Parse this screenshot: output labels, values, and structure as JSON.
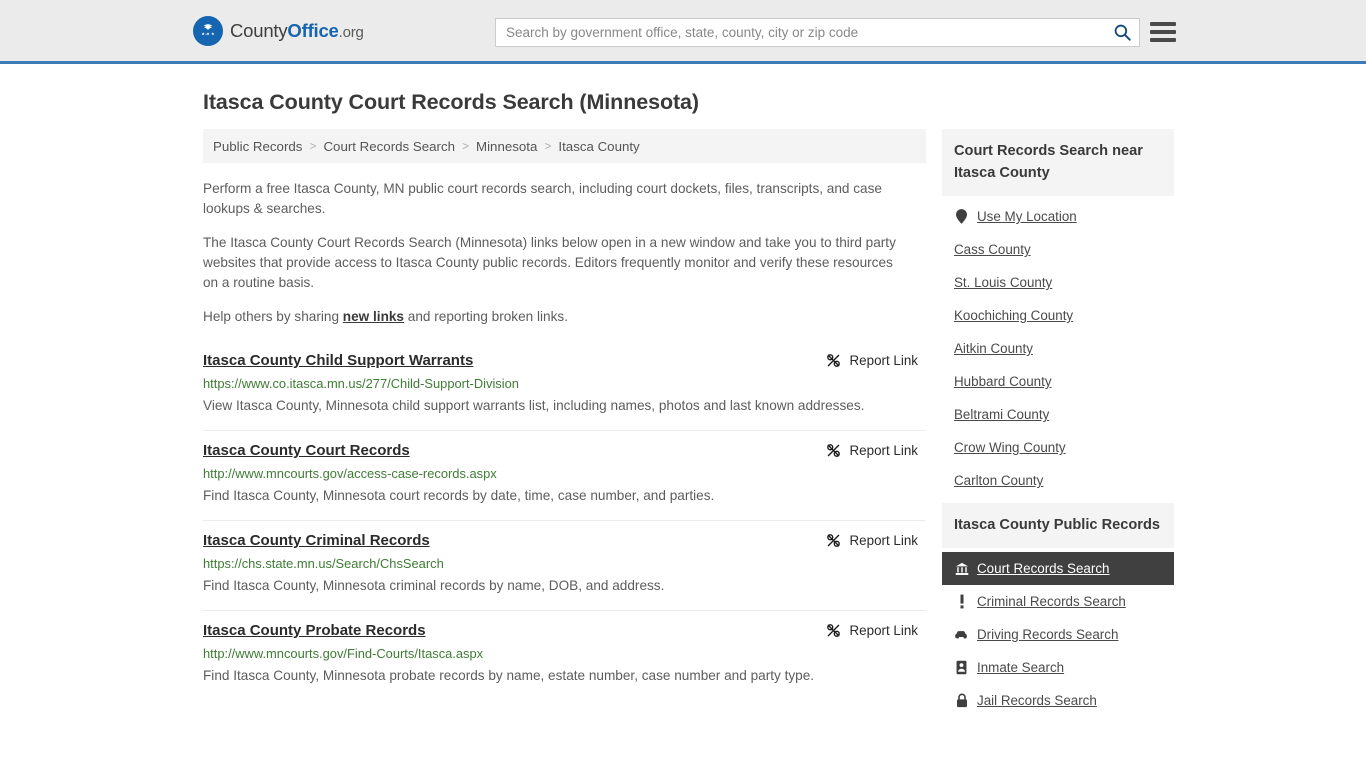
{
  "header": {
    "logo_county": "County",
    "logo_office": "Office",
    "logo_dotorg": ".org",
    "search_placeholder": "Search by government office, state, county, city or zip code",
    "search_value": "",
    "search_icon": "search-icon",
    "menu_icon": "hamburger-menu-icon"
  },
  "page": {
    "title": "Itasca County Court Records Search (Minnesota)"
  },
  "breadcrumb": {
    "items": [
      {
        "label": "Public Records",
        "current": false
      },
      {
        "label": "Court Records Search",
        "current": false
      },
      {
        "label": "Minnesota",
        "current": false
      },
      {
        "label": "Itasca County",
        "current": true
      }
    ],
    "separator": ">"
  },
  "intro": {
    "p1": "Perform a free Itasca County, MN public court records search, including court dockets, files, transcripts, and case lookups & searches.",
    "p2": "The Itasca County Court Records Search (Minnesota) links below open in a new window and take you to third party websites that provide access to Itasca County public records. Editors frequently monitor and verify these resources on a routine basis.",
    "p3_before": "Help others by sharing ",
    "p3_link": "new links",
    "p3_after": " and reporting broken links."
  },
  "results": {
    "report_label": "Report Link",
    "report_icon": "broken-link-icon",
    "items": [
      {
        "title": "Itasca County Child Support Warrants",
        "url": "https://www.co.itasca.mn.us/277/Child-Support-Division",
        "description": "View Itasca County, Minnesota child support warrants list, including names, photos and last known addresses."
      },
      {
        "title": "Itasca County Court Records",
        "url": "http://www.mncourts.gov/access-case-records.aspx",
        "description": "Find Itasca County, Minnesota court records by date, time, case number, and parties."
      },
      {
        "title": "Itasca County Criminal Records",
        "url": "https://chs.state.mn.us/Search/ChsSearch",
        "description": "Find Itasca County, Minnesota criminal records by name, DOB, and address."
      },
      {
        "title": "Itasca County Probate Records",
        "url": "http://www.mncourts.gov/Find-Courts/Itasca.aspx",
        "description": "Find Itasca County, Minnesota probate records by name, estate number, case number and party type."
      }
    ]
  },
  "sidebar": {
    "nearby": {
      "heading": "Court Records Search near Itasca County",
      "items": [
        {
          "label": "Use My Location",
          "icon": "map-pin-icon"
        },
        {
          "label": "Cass County",
          "icon": ""
        },
        {
          "label": "St. Louis County",
          "icon": ""
        },
        {
          "label": "Koochiching County",
          "icon": ""
        },
        {
          "label": "Aitkin County",
          "icon": ""
        },
        {
          "label": "Hubbard County",
          "icon": ""
        },
        {
          "label": "Beltrami County",
          "icon": ""
        },
        {
          "label": "Crow Wing County",
          "icon": ""
        },
        {
          "label": "Carlton County",
          "icon": ""
        }
      ]
    },
    "public_records": {
      "heading": "Itasca County Public Records",
      "items": [
        {
          "label": "Court Records Search",
          "icon": "courthouse-icon",
          "active": true
        },
        {
          "label": "Criminal Records Search",
          "icon": "exclamation-icon",
          "active": false
        },
        {
          "label": "Driving Records Search",
          "icon": "car-icon",
          "active": false
        },
        {
          "label": "Inmate Search",
          "icon": "id-badge-icon",
          "active": false
        },
        {
          "label": "Jail Records Search",
          "icon": "lock-icon",
          "active": false
        }
      ]
    }
  },
  "colors": {
    "brand_blue": "#1565b0",
    "header_border": "#3c7cb4",
    "url_green": "#3f7c35",
    "active_bg": "#404040",
    "card_bg": "#f4f4f4"
  }
}
